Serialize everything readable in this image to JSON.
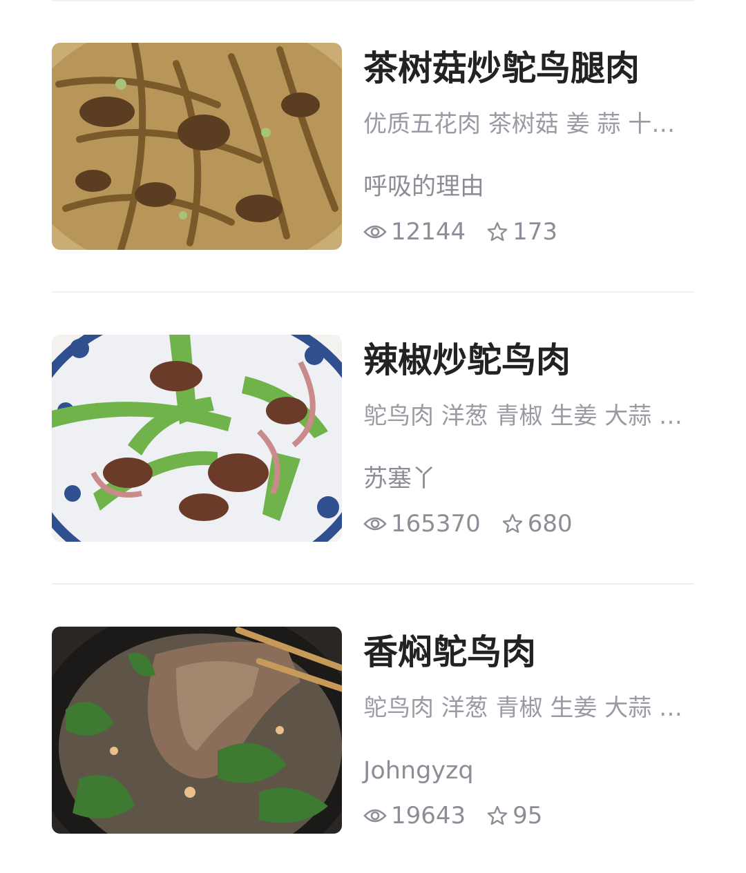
{
  "recipes": [
    {
      "title": "茶树菇炒鸵鸟腿肉",
      "ingredients": "优质五花肉 茶树菇 姜 蒜 十三香 生抽 老抽 蚝油",
      "author": "呼吸的理由",
      "views": "12144",
      "favorites": "173",
      "photo": "braised-ostrich-with-mushrooms-photo"
    },
    {
      "title": "辣椒炒鸵鸟肉",
      "ingredients": "鸵鸟肉 洋葱 青椒 生姜 大蒜 生抽 老抽",
      "author": "苏塞丫",
      "views": "165370",
      "favorites": "680",
      "photo": "ostrich-with-green-pepper-photo"
    },
    {
      "title": "香焖鸵鸟肉",
      "ingredients": "鸵鸟肉 洋葱 青椒 生姜 大蒜 生抽 老抽",
      "author": "Johngyzq",
      "views": "19643",
      "favorites": "95",
      "photo": "stewed-ostrich-pot-photo"
    }
  ],
  "icons": {
    "views": "eye-icon",
    "favorites": "star-icon"
  },
  "colors": {
    "title": "#222222",
    "meta": "#9b9aa4",
    "divider": "#efefef"
  }
}
